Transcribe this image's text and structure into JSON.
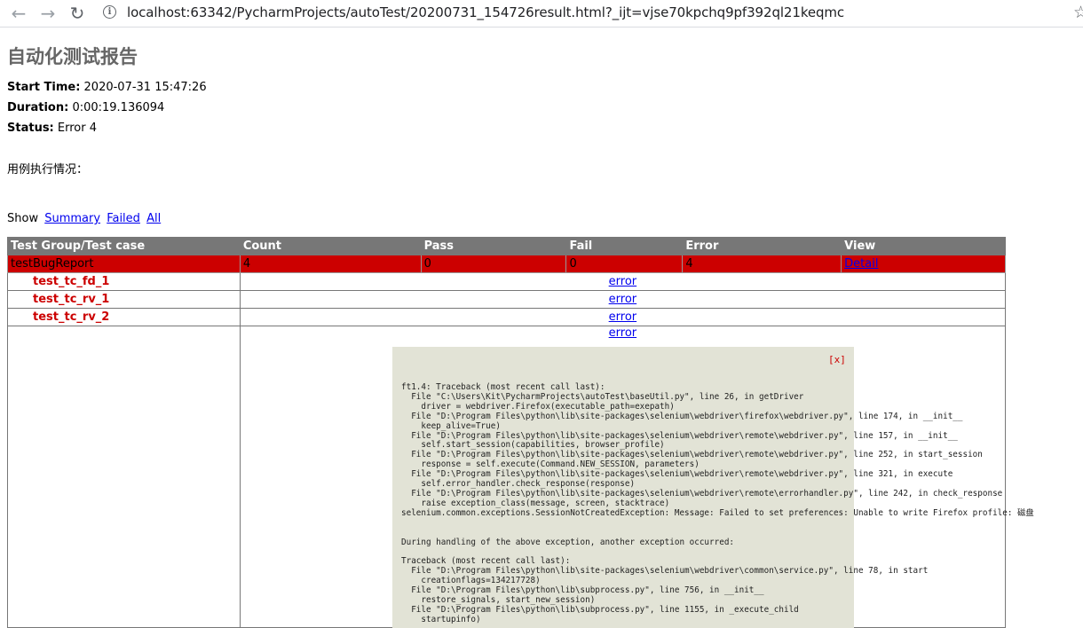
{
  "browser": {
    "url": "localhost:63342/PycharmProjects/autoTest/20200731_154726result.html?_ijt=vjse70kpchq9pf392ql21keqmc",
    "back_icon": "←",
    "forward_icon": "→",
    "reload_icon": "↻",
    "star_icon": "☆"
  },
  "report": {
    "title": "自动化测试报告",
    "start_time_label": "Start Time:",
    "start_time": "2020-07-31 15:47:26",
    "duration_label": "Duration:",
    "duration": "0:00:19.136094",
    "status_label": "Status:",
    "status": "Error 4",
    "description": "用例执行情况：",
    "show_label": "Show",
    "show_links": [
      "Summary",
      "Failed",
      "All"
    ]
  },
  "table": {
    "headers": [
      "Test Group/Test case",
      "Count",
      "Pass",
      "Fail",
      "Error",
      "View"
    ],
    "group": {
      "name": "testBugReport",
      "count": "4",
      "pass": "0",
      "fail": "0",
      "error": "4",
      "view": "Detail"
    },
    "cases": [
      {
        "name": "test_tc_fd_1",
        "result": "error"
      },
      {
        "name": "test_tc_rv_1",
        "result": "error"
      },
      {
        "name": "test_tc_rv_2",
        "result": "error"
      },
      {
        "name": "",
        "result": "error"
      }
    ]
  },
  "popup": {
    "close": "[x]",
    "traceback": "ft1.4: Traceback (most recent call last):\n  File \"C:\\Users\\Kit\\PycharmProjects\\autoTest\\baseUtil.py\", line 26, in getDriver\n    driver = webdriver.Firefox(executable_path=exepath)\n  File \"D:\\Program Files\\python\\lib\\site-packages\\selenium\\webdriver\\firefox\\webdriver.py\", line 174, in __init__\n    keep_alive=True)\n  File \"D:\\Program Files\\python\\lib\\site-packages\\selenium\\webdriver\\remote\\webdriver.py\", line 157, in __init__\n    self.start_session(capabilities, browser_profile)\n  File \"D:\\Program Files\\python\\lib\\site-packages\\selenium\\webdriver\\remote\\webdriver.py\", line 252, in start_session\n    response = self.execute(Command.NEW_SESSION, parameters)\n  File \"D:\\Program Files\\python\\lib\\site-packages\\selenium\\webdriver\\remote\\webdriver.py\", line 321, in execute\n    self.error_handler.check_response(response)\n  File \"D:\\Program Files\\python\\lib\\site-packages\\selenium\\webdriver\\remote\\errorhandler.py\", line 242, in check_response\n    raise exception_class(message, screen, stacktrace)\nselenium.common.exceptions.SessionNotCreatedException: Message: Failed to set preferences: Unable to write Firefox profile: 磁盘\n\n\nDuring handling of the above exception, another exception occurred:\n\nTraceback (most recent call last):\n  File \"D:\\Program Files\\python\\lib\\site-packages\\selenium\\webdriver\\common\\service.py\", line 78, in start\n    creationflags=134217728)\n  File \"D:\\Program Files\\python\\lib\\subprocess.py\", line 756, in __init__\n    restore_signals, start_new_session)\n  File \"D:\\Program Files\\python\\lib\\subprocess.py\", line 1155, in _execute_child\n    startupinfo)"
  }
}
